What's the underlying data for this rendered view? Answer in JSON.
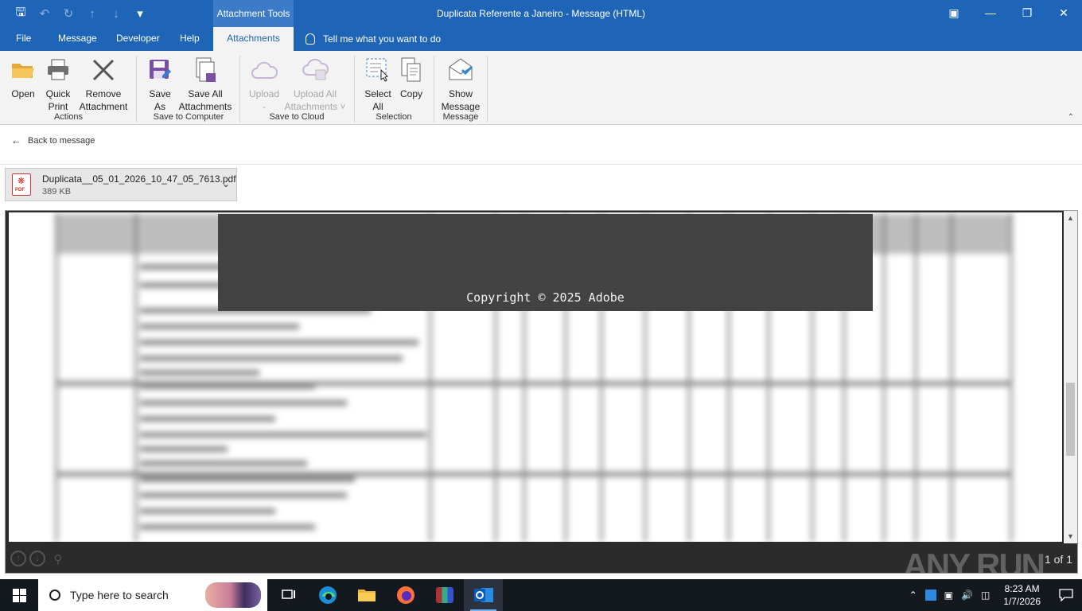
{
  "titlebar": {
    "context_tab": "Attachment Tools",
    "title": "Duplicata Referente a Janeiro  -  Message (HTML)"
  },
  "tabs": {
    "file": "File",
    "message": "Message",
    "developer": "Developer",
    "help": "Help",
    "attachments": "Attachments",
    "tell_me": "Tell me what you want to do"
  },
  "ribbon": {
    "open": "Open",
    "quick_print_1": "Quick",
    "quick_print_2": "Print",
    "remove_1": "Remove",
    "remove_2": "Attachment",
    "group_actions": "Actions",
    "save_as_1": "Save",
    "save_as_2": "As",
    "save_all_1": "Save All",
    "save_all_2": "Attachments",
    "group_save_computer": "Save to Computer",
    "upload": "Upload",
    "upload_all_1": "Upload All",
    "upload_all_2": "Attachments",
    "group_save_cloud": "Save to Cloud",
    "select_all_1": "Select",
    "select_all_2": "All",
    "copy": "Copy",
    "group_selection": "Selection",
    "show_message_1": "Show",
    "show_message_2": "Message",
    "group_message": "Message"
  },
  "back_link": "Back to message",
  "attachment": {
    "name": "Duplicata__05_01_2026_10_47_05_7613.pdf",
    "size": "389 KB"
  },
  "preview": {
    "copyright": "Copyright © 2025 Adobe",
    "page_count": "1 of 1",
    "watermark": "ANY RUN"
  },
  "taskbar": {
    "search_placeholder": "Type here to search",
    "time": "8:23 AM",
    "date": "1/7/2026"
  },
  "colors": {
    "accent": "#1f65b7",
    "ribbon_bg": "#f3f3f3",
    "taskbar_bg": "#14181f"
  }
}
